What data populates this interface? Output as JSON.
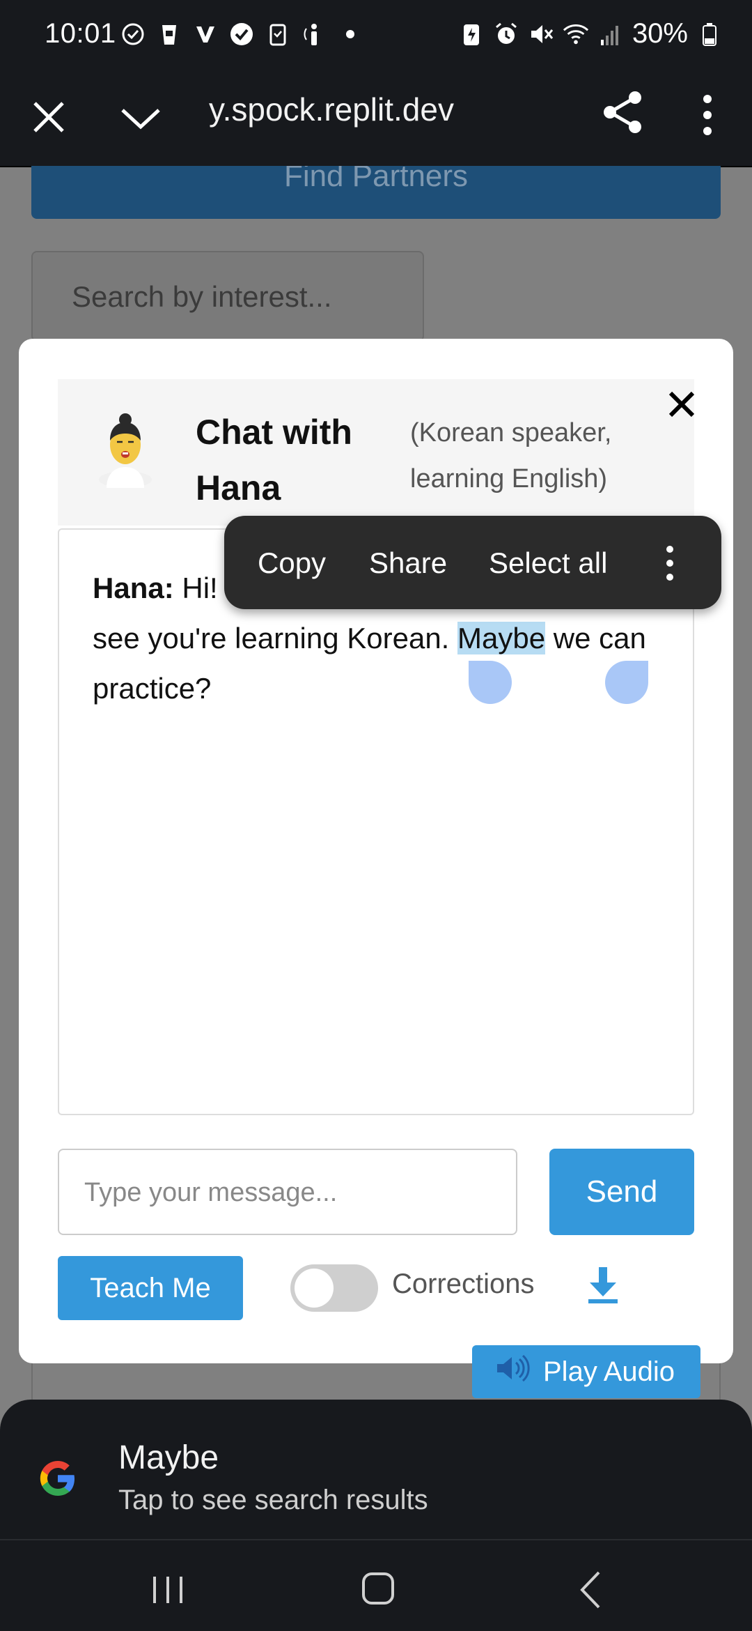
{
  "status_bar": {
    "time": "10:01",
    "battery_percent": "30%",
    "icons": [
      "check-circle-icon",
      "cup-icon",
      "v-icon",
      "verified-icon",
      "clipboard-icon",
      "info-icon",
      "dot-icon",
      "battery-saver-icon",
      "alarm-icon",
      "mute-icon",
      "wifi-icon",
      "signal-icon",
      "battery-icon"
    ]
  },
  "browser": {
    "url": "y.spock.replit.dev"
  },
  "background_page": {
    "find_button_label": "Find Partners",
    "search_placeholder": "Search by interest..."
  },
  "chat": {
    "title": "Chat with Hana",
    "subtitle": "(Korean speaker, learning English)",
    "message_sender": "Hana:",
    "message_part1": " Hi! ",
    "message_part2": "see you're learning Korean. ",
    "message_selected": "Maybe",
    "message_part3": " we can practice?",
    "input_placeholder": "Type your message...",
    "send_label": "Send",
    "teach_label": "Teach Me",
    "corrections_label": "Corrections",
    "corrections_enabled": false,
    "play_audio_label": "Play Audio"
  },
  "context_menu": {
    "copy": "Copy",
    "share": "Share",
    "select_all": "Select all"
  },
  "google_sheet": {
    "word": "Maybe",
    "hint": "Tap to see search results"
  },
  "colors": {
    "accent": "#3498db",
    "dark_bar": "#17191d",
    "selection": "#b7dcf3",
    "handle": "#a9c7f7"
  }
}
